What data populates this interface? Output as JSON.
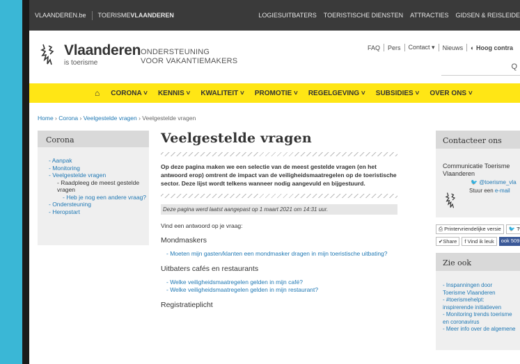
{
  "topbar": {
    "vlaanderen": "VLAANDEREN.be",
    "toerisme_prefix": "TOERISME",
    "toerisme_bold": "VLAANDEREN",
    "links": [
      "LOGIESUITBATERS",
      "TOERISTISCHE DIENSTEN",
      "ATTRACTIES",
      "GIDSEN & REISLEIDE"
    ]
  },
  "header": {
    "brand": "Vlaanderen",
    "brand_sub": "is toerisme",
    "tagline_1": "ONDERSTEUNING",
    "tagline_2": "VOOR VAKANTIEMAKERS",
    "util": [
      "FAQ",
      "Pers",
      "Contact ▾",
      "Nieuws",
      "◐ Hoog contra"
    ],
    "search_icon": "Q"
  },
  "nav": {
    "home_icon": "⌂",
    "items": [
      "CORONA ˅",
      "KENNIS ˅",
      "KWALITEIT ˅",
      "PROMOTIE ˅",
      "REGELGEVING ˅",
      "SUBSIDIES ˅",
      "OVER ONS ˅"
    ]
  },
  "breadcrumb": {
    "home": "Home",
    "corona": "Corona",
    "veelgestelde": "Veelgestelde vragen",
    "current": "Veelgestelde vragen",
    "sep": " › "
  },
  "left": {
    "title": "Corona",
    "items": [
      "- Aanpak",
      "- Monitoring",
      "- Veelgestelde vragen",
      "- Raadpleeg de meest gestelde vragen",
      "- Heb je nog een andere vraag?",
      "- Ondersteuning",
      "- Heropstart"
    ]
  },
  "main": {
    "title": "Veelgestelde vragen",
    "intro": "Op deze pagina maken we een selectie van de meest gestelde vragen (en het antwoord erop) omtrent de impact van de veiligheidsmaatregelen op de toeristische sector. Deze lijst wordt telkens wanneer nodig aangevuld en bijgestuurd.",
    "updated": "Deze pagina werd laatst aangepast op 1 maart 2021 om 14:31 uur.",
    "find": "Vind een antwoord op je vraag:",
    "sec1": "Mondmaskers",
    "sec1_link": "- Moeten mijn gasten/klanten een mondmasker dragen in mijn toeristische uitbating?",
    "sec2": "Uitbaters cafés en restaurants",
    "sec2_link1": "- Welke veiligheidsmaatregelen gelden in mijn café?",
    "sec2_link2": "- Welke veiligheidsmaatregelen gelden in mijn restaurant?",
    "sec3": "Registratieplicht"
  },
  "right": {
    "contact_title": "Contacteer ons",
    "org": "Communicatie Toerisme Vlaanderen",
    "twitter": "@toerisme_vla",
    "mail_prefix": "Stuur een ",
    "mail_link": "e-mail",
    "print": "⎙ Printervriendelijke versie",
    "tweet": "🐦 Tweeten",
    "share": "✔Share",
    "like": "f Vind ik leuk",
    "like_count": "ook 509",
    "zie_title": "Zie ook",
    "zie_items": [
      "- Inspanningen door Toerisme Vlaanderen",
      "- #toerismehelpt: inspirerende initiatieven",
      "- Monitoring trends toerisme en coronavirus",
      "- Meer info over de algemene"
    ]
  },
  "colors": {
    "nav_yellow": "#ffe615",
    "link_blue": "#1f78b4",
    "topbar": "#3a3a3a",
    "frame": "#1b1b1b",
    "bg": "#3ab7d6"
  }
}
